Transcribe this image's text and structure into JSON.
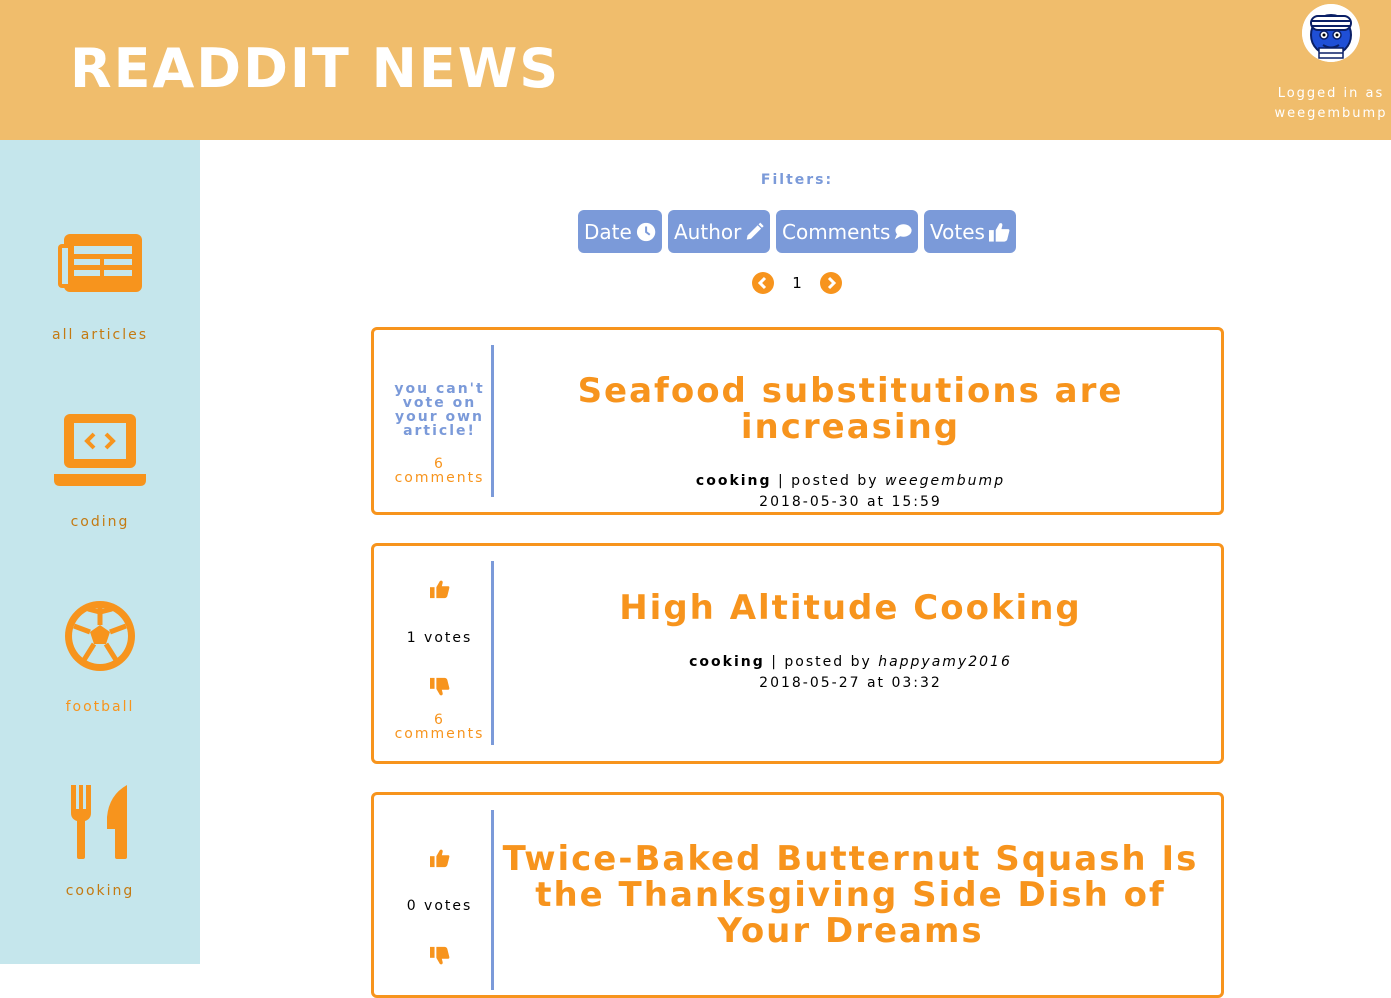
{
  "header": {
    "title": "READDIT NEWS",
    "login_line1": "Logged in as",
    "login_line2": "weegembump",
    "avatar_icon": "user-avatar-icon"
  },
  "colors": {
    "header_bg": "#f0bd6c",
    "sidebar_bg": "#c5e6ec",
    "accent_orange": "#f7941d",
    "accent_blue": "#7b9ad9"
  },
  "sidebar": {
    "items": [
      {
        "label": "all articles",
        "icon": "newspaper-icon"
      },
      {
        "label": "coding",
        "icon": "laptop-code-icon"
      },
      {
        "label": "football",
        "icon": "soccer-ball-icon"
      },
      {
        "label": "cooking",
        "icon": "utensils-icon"
      }
    ]
  },
  "filters": {
    "label": "Filters:",
    "buttons": [
      {
        "label": "Date",
        "icon": "clock-icon"
      },
      {
        "label": "Author",
        "icon": "pencil-icon"
      },
      {
        "label": "Comments",
        "icon": "speech-bubble-icon"
      },
      {
        "label": "Votes",
        "icon": "thumbs-up-icon"
      }
    ]
  },
  "pagination": {
    "page": "1"
  },
  "articles": [
    {
      "title": "Seafood substitutions are increasing",
      "topic": "cooking",
      "posted_by_text": "| posted by",
      "author": "weegembump",
      "date": "2018-05-30 at 15:59",
      "own_article_note": "you can't vote on your own article!",
      "comments": "6 comments"
    },
    {
      "title": "High Altitude Cooking",
      "topic": "cooking",
      "posted_by_text": "| posted by",
      "author": "happyamy2016",
      "date": "2018-05-27 at 03:32",
      "votes": "1 votes",
      "comments": "6 comments"
    },
    {
      "title": "Twice-Baked Butternut Squash Is the Thanksgiving Side Dish of Your Dreams",
      "votes": "0 votes"
    }
  ]
}
